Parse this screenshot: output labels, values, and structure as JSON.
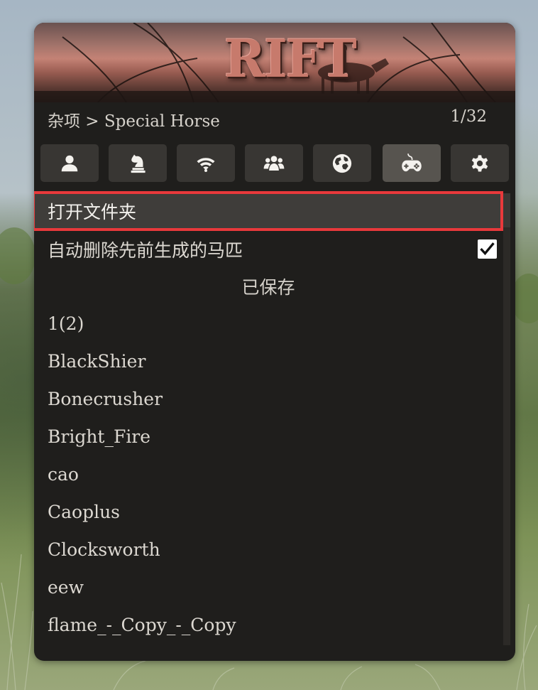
{
  "app": {
    "logo_text": "RIFT"
  },
  "header": {
    "breadcrumb": "杂项 > Special Horse",
    "page_counter": "1/32"
  },
  "tabs": [
    {
      "icon": "person-icon",
      "active": false
    },
    {
      "icon": "chess-knight-icon",
      "active": false
    },
    {
      "icon": "wifi-icon",
      "active": false
    },
    {
      "icon": "users-icon",
      "active": false
    },
    {
      "icon": "globe-icon",
      "active": false
    },
    {
      "icon": "gamepad-icon",
      "active": true
    },
    {
      "icon": "gear-icon",
      "active": false
    }
  ],
  "menu": {
    "open_folder": "打开文件夹",
    "auto_delete": "自动删除先前生成的马匹",
    "auto_delete_checked": true,
    "saved_header": "已保存",
    "saved_items": [
      "1(2)",
      "BlackShier",
      "Bonecrusher",
      "Bright_Fire",
      "cao",
      "Caoplus",
      "Clocksworth",
      "eew",
      "flame_-_Copy_-_Copy"
    ]
  },
  "colors": {
    "highlight": "#e8393b",
    "panel_bg": "#1f1e1c",
    "tab_bg": "#383633",
    "tab_active_bg": "#57544f"
  }
}
